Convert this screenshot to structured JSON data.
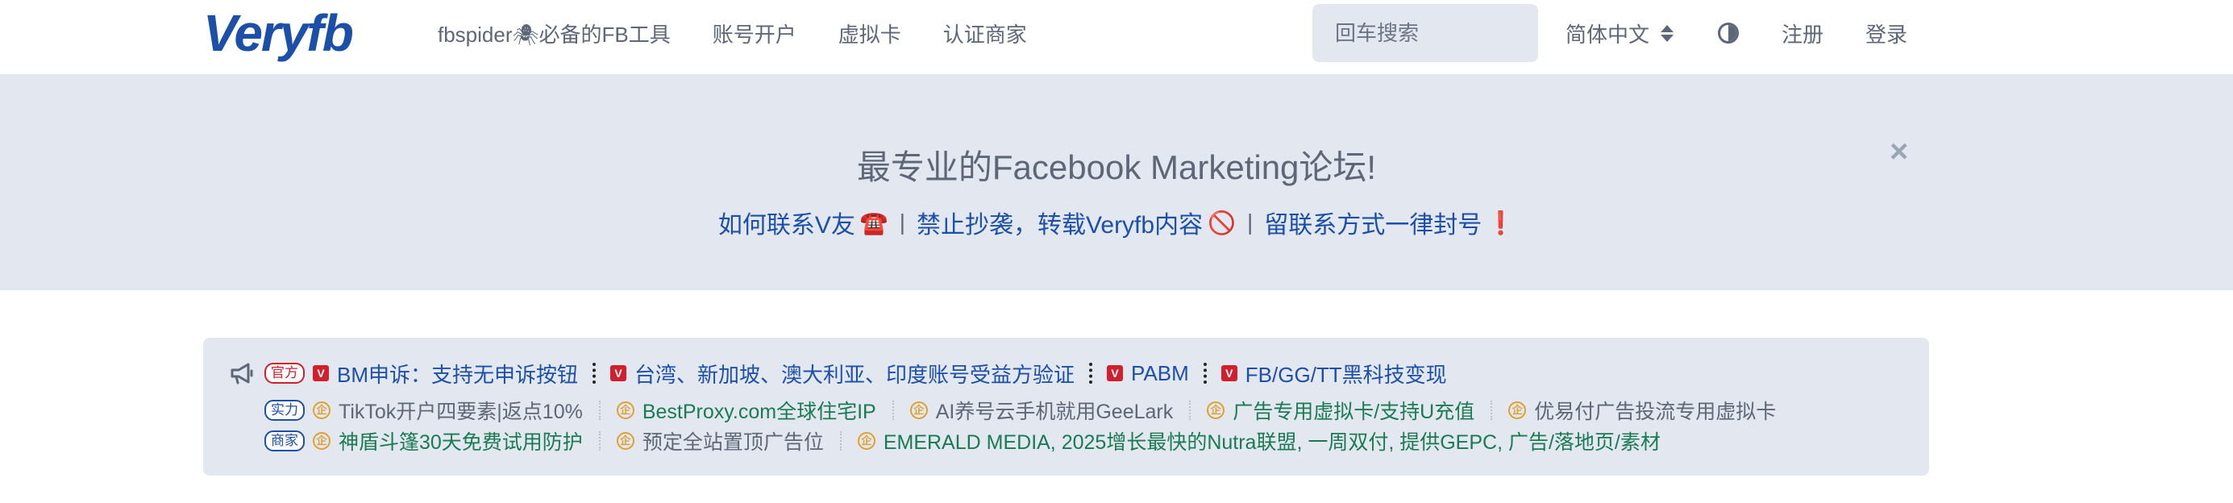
{
  "header": {
    "logo_text": "Veryfb",
    "nav": [
      "fbspider🕷必备的FB工具",
      "账号开户",
      "虚拟卡",
      "认证商家"
    ],
    "search_placeholder": "回车搜索",
    "language": "简体中文",
    "register": "注册",
    "login": "登录"
  },
  "banner": {
    "title": "最专业的Facebook Marketing论坛!",
    "links": [
      {
        "label": "如何联系V友",
        "emoji": "☎️"
      },
      {
        "label": "禁止抄袭，转载Veryfb内容",
        "emoji": "🚫"
      },
      {
        "label": "留联系方式一律封号",
        "emoji": "❗"
      }
    ],
    "separator": "|",
    "close": "×"
  },
  "announcements": {
    "row1_tag": "官方",
    "row1_links": [
      "BM申诉：支持无申诉按钮",
      "台湾、新加坡、澳大利亚、印度账号受益方验证",
      "PABM",
      "FB/GG/TT黑科技变现"
    ],
    "row2_tag": "实力",
    "row2_links": [
      {
        "label": "TikTok开户四要素|返点10%",
        "color": "gray"
      },
      {
        "label": "BestProxy.com全球住宅IP",
        "color": "green"
      },
      {
        "label": "AI养号云手机就用GeeLark",
        "color": "gray"
      },
      {
        "label": "广告专用虚拟卡/支持U充值",
        "color": "green"
      },
      {
        "label": "优易付广告投流专用虚拟卡",
        "color": "gray"
      }
    ],
    "row3_tag": "商家",
    "row3_links": [
      {
        "label": "神盾斗篷30天免费试用防护",
        "color": "green"
      },
      {
        "label": "预定全站置顶广告位",
        "color": "gray"
      },
      {
        "label": "EMERALD MEDIA, 2025增长最快的Nutra联盟, 一周双付, 提供GEPC, 广告/落地页/素材",
        "color": "green"
      }
    ],
    "vbadge": "V",
    "qi_icon": "企"
  },
  "colors": {
    "brand_blue": "#1c4fa8",
    "banner_bg": "#e3e8f0",
    "text_gray": "#5d6778",
    "link_green": "#1a7a52",
    "tag_red": "#d0202e"
  }
}
